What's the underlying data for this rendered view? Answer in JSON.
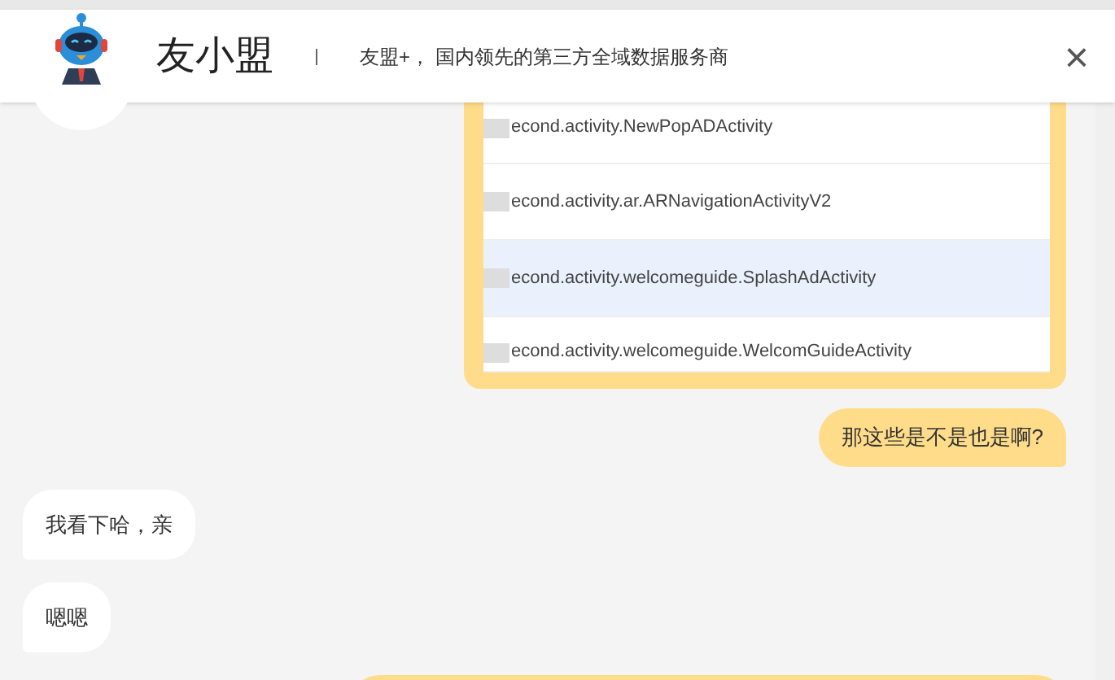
{
  "header": {
    "title": "友小盟",
    "tagline": "友盟+， 国内领先的第三方全域数据服务商",
    "close": "×"
  },
  "activity_card": {
    "rows": [
      {
        "text": "econd.activity.NewPopADActivity",
        "highlighted": false
      },
      {
        "text": "econd.activity.ar.ARNavigationActivityV2",
        "highlighted": false
      },
      {
        "text": "econd.activity.welcomeguide.SplashAdActivity",
        "highlighted": true
      },
      {
        "text": "econd.activity.welcomeguide.WelcomGuideActivity",
        "highlighted": false
      }
    ]
  },
  "messages": [
    {
      "kind": "sent",
      "text": "那这些是不是也是啊?"
    },
    {
      "kind": "received",
      "text": "我看下哈，亲"
    },
    {
      "kind": "received",
      "text": "嗯嗯"
    },
    {
      "kind": "sent"
    }
  ]
}
